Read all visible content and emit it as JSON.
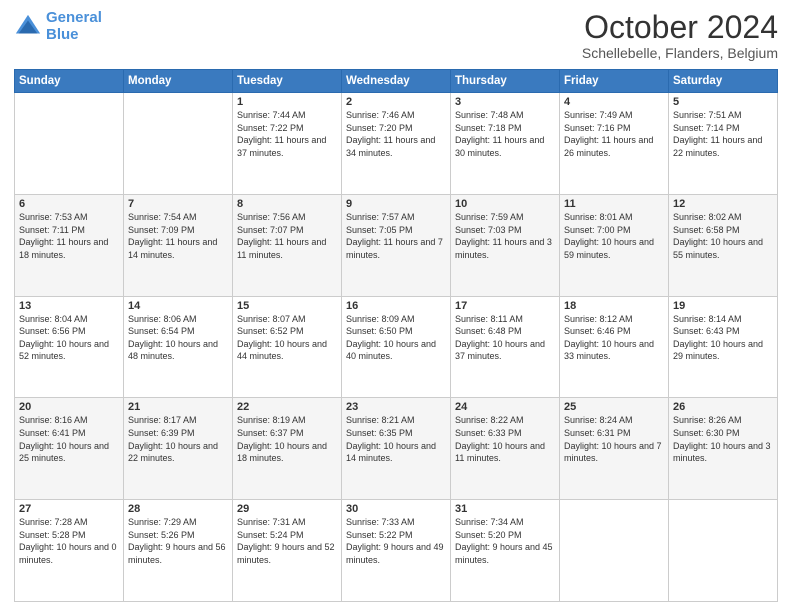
{
  "header": {
    "logo_line1": "General",
    "logo_line2": "Blue",
    "month": "October 2024",
    "location": "Schellebelle, Flanders, Belgium"
  },
  "days_of_week": [
    "Sunday",
    "Monday",
    "Tuesday",
    "Wednesday",
    "Thursday",
    "Friday",
    "Saturday"
  ],
  "weeks": [
    [
      {
        "day": "",
        "sunrise": "",
        "sunset": "",
        "daylight": ""
      },
      {
        "day": "",
        "sunrise": "",
        "sunset": "",
        "daylight": ""
      },
      {
        "day": "1",
        "sunrise": "Sunrise: 7:44 AM",
        "sunset": "Sunset: 7:22 PM",
        "daylight": "Daylight: 11 hours and 37 minutes."
      },
      {
        "day": "2",
        "sunrise": "Sunrise: 7:46 AM",
        "sunset": "Sunset: 7:20 PM",
        "daylight": "Daylight: 11 hours and 34 minutes."
      },
      {
        "day": "3",
        "sunrise": "Sunrise: 7:48 AM",
        "sunset": "Sunset: 7:18 PM",
        "daylight": "Daylight: 11 hours and 30 minutes."
      },
      {
        "day": "4",
        "sunrise": "Sunrise: 7:49 AM",
        "sunset": "Sunset: 7:16 PM",
        "daylight": "Daylight: 11 hours and 26 minutes."
      },
      {
        "day": "5",
        "sunrise": "Sunrise: 7:51 AM",
        "sunset": "Sunset: 7:14 PM",
        "daylight": "Daylight: 11 hours and 22 minutes."
      }
    ],
    [
      {
        "day": "6",
        "sunrise": "Sunrise: 7:53 AM",
        "sunset": "Sunset: 7:11 PM",
        "daylight": "Daylight: 11 hours and 18 minutes."
      },
      {
        "day": "7",
        "sunrise": "Sunrise: 7:54 AM",
        "sunset": "Sunset: 7:09 PM",
        "daylight": "Daylight: 11 hours and 14 minutes."
      },
      {
        "day": "8",
        "sunrise": "Sunrise: 7:56 AM",
        "sunset": "Sunset: 7:07 PM",
        "daylight": "Daylight: 11 hours and 11 minutes."
      },
      {
        "day": "9",
        "sunrise": "Sunrise: 7:57 AM",
        "sunset": "Sunset: 7:05 PM",
        "daylight": "Daylight: 11 hours and 7 minutes."
      },
      {
        "day": "10",
        "sunrise": "Sunrise: 7:59 AM",
        "sunset": "Sunset: 7:03 PM",
        "daylight": "Daylight: 11 hours and 3 minutes."
      },
      {
        "day": "11",
        "sunrise": "Sunrise: 8:01 AM",
        "sunset": "Sunset: 7:00 PM",
        "daylight": "Daylight: 10 hours and 59 minutes."
      },
      {
        "day": "12",
        "sunrise": "Sunrise: 8:02 AM",
        "sunset": "Sunset: 6:58 PM",
        "daylight": "Daylight: 10 hours and 55 minutes."
      }
    ],
    [
      {
        "day": "13",
        "sunrise": "Sunrise: 8:04 AM",
        "sunset": "Sunset: 6:56 PM",
        "daylight": "Daylight: 10 hours and 52 minutes."
      },
      {
        "day": "14",
        "sunrise": "Sunrise: 8:06 AM",
        "sunset": "Sunset: 6:54 PM",
        "daylight": "Daylight: 10 hours and 48 minutes."
      },
      {
        "day": "15",
        "sunrise": "Sunrise: 8:07 AM",
        "sunset": "Sunset: 6:52 PM",
        "daylight": "Daylight: 10 hours and 44 minutes."
      },
      {
        "day": "16",
        "sunrise": "Sunrise: 8:09 AM",
        "sunset": "Sunset: 6:50 PM",
        "daylight": "Daylight: 10 hours and 40 minutes."
      },
      {
        "day": "17",
        "sunrise": "Sunrise: 8:11 AM",
        "sunset": "Sunset: 6:48 PM",
        "daylight": "Daylight: 10 hours and 37 minutes."
      },
      {
        "day": "18",
        "sunrise": "Sunrise: 8:12 AM",
        "sunset": "Sunset: 6:46 PM",
        "daylight": "Daylight: 10 hours and 33 minutes."
      },
      {
        "day": "19",
        "sunrise": "Sunrise: 8:14 AM",
        "sunset": "Sunset: 6:43 PM",
        "daylight": "Daylight: 10 hours and 29 minutes."
      }
    ],
    [
      {
        "day": "20",
        "sunrise": "Sunrise: 8:16 AM",
        "sunset": "Sunset: 6:41 PM",
        "daylight": "Daylight: 10 hours and 25 minutes."
      },
      {
        "day": "21",
        "sunrise": "Sunrise: 8:17 AM",
        "sunset": "Sunset: 6:39 PM",
        "daylight": "Daylight: 10 hours and 22 minutes."
      },
      {
        "day": "22",
        "sunrise": "Sunrise: 8:19 AM",
        "sunset": "Sunset: 6:37 PM",
        "daylight": "Daylight: 10 hours and 18 minutes."
      },
      {
        "day": "23",
        "sunrise": "Sunrise: 8:21 AM",
        "sunset": "Sunset: 6:35 PM",
        "daylight": "Daylight: 10 hours and 14 minutes."
      },
      {
        "day": "24",
        "sunrise": "Sunrise: 8:22 AM",
        "sunset": "Sunset: 6:33 PM",
        "daylight": "Daylight: 10 hours and 11 minutes."
      },
      {
        "day": "25",
        "sunrise": "Sunrise: 8:24 AM",
        "sunset": "Sunset: 6:31 PM",
        "daylight": "Daylight: 10 hours and 7 minutes."
      },
      {
        "day": "26",
        "sunrise": "Sunrise: 8:26 AM",
        "sunset": "Sunset: 6:30 PM",
        "daylight": "Daylight: 10 hours and 3 minutes."
      }
    ],
    [
      {
        "day": "27",
        "sunrise": "Sunrise: 7:28 AM",
        "sunset": "Sunset: 5:28 PM",
        "daylight": "Daylight: 10 hours and 0 minutes."
      },
      {
        "day": "28",
        "sunrise": "Sunrise: 7:29 AM",
        "sunset": "Sunset: 5:26 PM",
        "daylight": "Daylight: 9 hours and 56 minutes."
      },
      {
        "day": "29",
        "sunrise": "Sunrise: 7:31 AM",
        "sunset": "Sunset: 5:24 PM",
        "daylight": "Daylight: 9 hours and 52 minutes."
      },
      {
        "day": "30",
        "sunrise": "Sunrise: 7:33 AM",
        "sunset": "Sunset: 5:22 PM",
        "daylight": "Daylight: 9 hours and 49 minutes."
      },
      {
        "day": "31",
        "sunrise": "Sunrise: 7:34 AM",
        "sunset": "Sunset: 5:20 PM",
        "daylight": "Daylight: 9 hours and 45 minutes."
      },
      {
        "day": "",
        "sunrise": "",
        "sunset": "",
        "daylight": ""
      },
      {
        "day": "",
        "sunrise": "",
        "sunset": "",
        "daylight": ""
      }
    ]
  ]
}
